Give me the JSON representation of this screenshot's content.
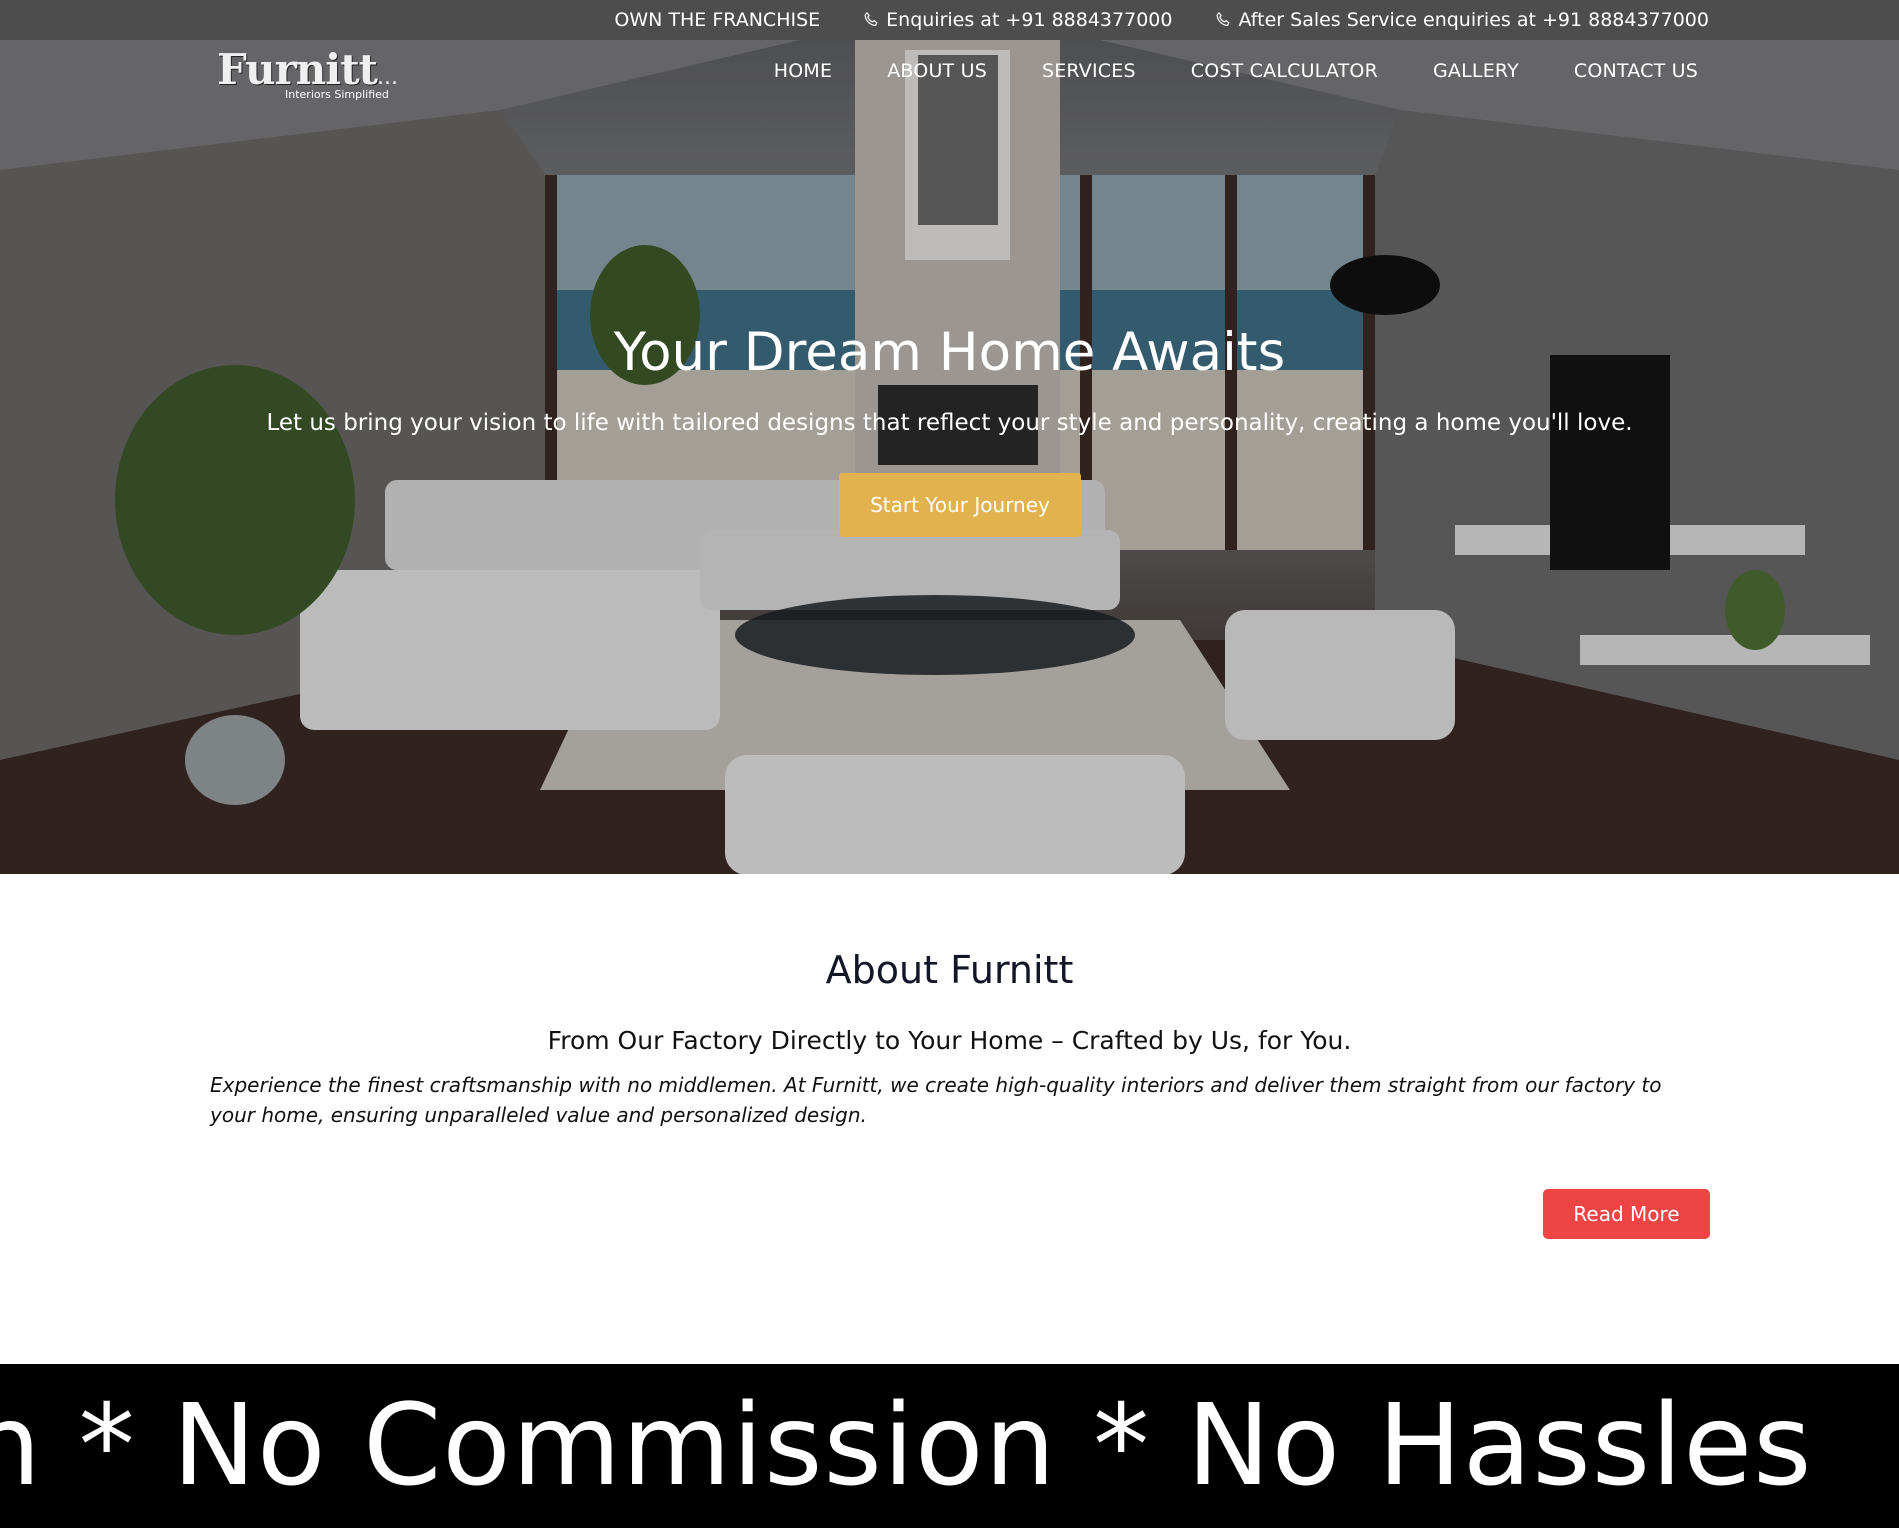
{
  "topbar": {
    "franchise": "OWN THE FRANCHISE",
    "enquiries": "Enquiries at +91 8884377000",
    "after_sales": "After Sales Service enquiries at +91 8884377000"
  },
  "logo": {
    "name": "Furnitt",
    "dots": "...",
    "tagline": "Interiors Simplified"
  },
  "nav": {
    "items": [
      {
        "label": "HOME"
      },
      {
        "label": "ABOUT US"
      },
      {
        "label": "SERVICES"
      },
      {
        "label": "COST CALCULATOR"
      },
      {
        "label": "GALLERY"
      },
      {
        "label": "CONTACT US"
      }
    ]
  },
  "hero": {
    "title": "Your Dream Home Awaits",
    "subtitle": "Let us bring your vision to life with tailored designs that reflect your style and personality, creating a home you'll love.",
    "cta": "Start Your Journey"
  },
  "about": {
    "title": "About Furnitt",
    "tagline": "From Our Factory Directly to Your Home – Crafted by Us, for You.",
    "description": "Experience the finest craftsmanship with no middlemen. At Furnitt, we create high-quality interiors and deliver them straight from our factory to your home, ensuring unparalleled value and personalized design.",
    "read_more": "Read More"
  },
  "marquee": {
    "text": "n * No Commission * No Hassles"
  },
  "colors": {
    "accent_gold": "#e1b24d",
    "read_more_red": "#ef4444",
    "marquee_bg": "#000000"
  }
}
